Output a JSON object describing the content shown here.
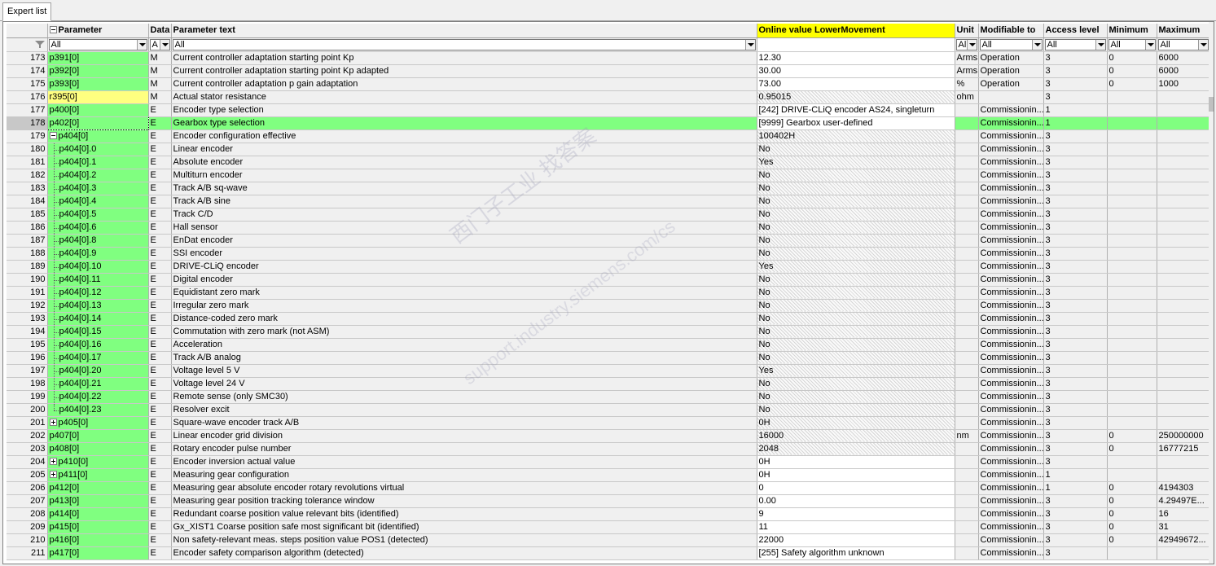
{
  "tab": {
    "label": "Expert list"
  },
  "headers": {
    "parameter": "Parameter",
    "data": "Data",
    "text": "Parameter text",
    "online": "Online value LowerMovement",
    "unit": "Unit",
    "modifiable": "Modifiable to",
    "access": "Access level",
    "minimum": "Minimum",
    "maximum": "Maximum"
  },
  "filters": {
    "parameter": "All",
    "data": "A",
    "text": "All",
    "unit": "Al",
    "modifiable": "All",
    "access": "All",
    "minimum": "All",
    "maximum": "All"
  },
  "watermark": {
    "line1": "西门子工业   找答案",
    "line2": "support.industry.siemens.com/cs"
  },
  "colors": {
    "parameter_green": "#80ff80",
    "online_header_yellow": "#ffff00",
    "read_only_param": "#ffff80"
  },
  "rows": [
    {
      "no": "173",
      "par": "p391[0]",
      "data": "M",
      "text": "Current controller adaptation starting point Kp",
      "online": "12.30",
      "unit": "Arms",
      "mod": "Operation",
      "acc": "3",
      "min": "0",
      "max": "6000",
      "ro": false
    },
    {
      "no": "174",
      "par": "p392[0]",
      "data": "M",
      "text": "Current controller adaptation starting point Kp adapted",
      "online": "30.00",
      "unit": "Arms",
      "mod": "Operation",
      "acc": "3",
      "min": "0",
      "max": "6000",
      "ro": false
    },
    {
      "no": "175",
      "par": "p393[0]",
      "data": "M",
      "text": "Current controller adaptation p gain adaptation",
      "online": "73.00",
      "unit": "%",
      "mod": "Operation",
      "acc": "3",
      "min": "0",
      "max": "1000",
      "ro": false
    },
    {
      "no": "176",
      "par": "r395[0]",
      "data": "M",
      "text": "Actual stator resistance",
      "online": "0.95015",
      "unit": "ohm",
      "mod": "",
      "acc": "3",
      "min": "",
      "max": "",
      "ro": true,
      "yellow": true
    },
    {
      "no": "177",
      "par": "p400[0]",
      "data": "E",
      "text": "Encoder type selection",
      "online": "[242] DRIVE-CLiQ encoder AS24, singleturn",
      "unit": "",
      "mod": "Commissionin...",
      "acc": "1",
      "min": "",
      "max": "",
      "ro": false
    },
    {
      "no": "178",
      "par": "p402[0]",
      "data": "E",
      "text": "Gearbox type selection",
      "online": "[9999] Gearbox user-defined",
      "unit": "",
      "mod": "Commissionin...",
      "acc": "1",
      "min": "",
      "max": "",
      "ro": false,
      "sel": true
    },
    {
      "no": "179",
      "par": "p404[0]",
      "data": "E",
      "text": "Encoder configuration effective",
      "online": "100402H",
      "unit": "",
      "mod": "Commissionin...",
      "acc": "3",
      "min": "",
      "max": "",
      "ro": true,
      "tree": "minus"
    },
    {
      "no": "180",
      "par": "p404[0].0",
      "data": "E",
      "text": "Linear encoder",
      "online": "No",
      "unit": "",
      "mod": "Commissionin...",
      "acc": "3",
      "min": "",
      "max": "",
      "ro": true,
      "child": true
    },
    {
      "no": "181",
      "par": "p404[0].1",
      "data": "E",
      "text": "Absolute encoder",
      "online": "Yes",
      "unit": "",
      "mod": "Commissionin...",
      "acc": "3",
      "min": "",
      "max": "",
      "ro": true,
      "child": true
    },
    {
      "no": "182",
      "par": "p404[0].2",
      "data": "E",
      "text": "Multiturn encoder",
      "online": "No",
      "unit": "",
      "mod": "Commissionin...",
      "acc": "3",
      "min": "",
      "max": "",
      "ro": true,
      "child": true
    },
    {
      "no": "183",
      "par": "p404[0].3",
      "data": "E",
      "text": "Track A/B sq-wave",
      "online": "No",
      "unit": "",
      "mod": "Commissionin...",
      "acc": "3",
      "min": "",
      "max": "",
      "ro": true,
      "child": true
    },
    {
      "no": "184",
      "par": "p404[0].4",
      "data": "E",
      "text": "Track A/B sine",
      "online": "No",
      "unit": "",
      "mod": "Commissionin...",
      "acc": "3",
      "min": "",
      "max": "",
      "ro": true,
      "child": true
    },
    {
      "no": "185",
      "par": "p404[0].5",
      "data": "E",
      "text": "Track C/D",
      "online": "No",
      "unit": "",
      "mod": "Commissionin...",
      "acc": "3",
      "min": "",
      "max": "",
      "ro": true,
      "child": true
    },
    {
      "no": "186",
      "par": "p404[0].6",
      "data": "E",
      "text": "Hall sensor",
      "online": "No",
      "unit": "",
      "mod": "Commissionin...",
      "acc": "3",
      "min": "",
      "max": "",
      "ro": true,
      "child": true
    },
    {
      "no": "187",
      "par": "p404[0].8",
      "data": "E",
      "text": "EnDat encoder",
      "online": "No",
      "unit": "",
      "mod": "Commissionin...",
      "acc": "3",
      "min": "",
      "max": "",
      "ro": true,
      "child": true
    },
    {
      "no": "188",
      "par": "p404[0].9",
      "data": "E",
      "text": "SSI encoder",
      "online": "No",
      "unit": "",
      "mod": "Commissionin...",
      "acc": "3",
      "min": "",
      "max": "",
      "ro": true,
      "child": true
    },
    {
      "no": "189",
      "par": "p404[0].10",
      "data": "E",
      "text": "DRIVE-CLiQ encoder",
      "online": "Yes",
      "unit": "",
      "mod": "Commissionin...",
      "acc": "3",
      "min": "",
      "max": "",
      "ro": true,
      "child": true
    },
    {
      "no": "190",
      "par": "p404[0].11",
      "data": "E",
      "text": "Digital encoder",
      "online": "No",
      "unit": "",
      "mod": "Commissionin...",
      "acc": "3",
      "min": "",
      "max": "",
      "ro": true,
      "child": true
    },
    {
      "no": "191",
      "par": "p404[0].12",
      "data": "E",
      "text": "Equidistant zero mark",
      "online": "No",
      "unit": "",
      "mod": "Commissionin...",
      "acc": "3",
      "min": "",
      "max": "",
      "ro": true,
      "child": true
    },
    {
      "no": "192",
      "par": "p404[0].13",
      "data": "E",
      "text": "Irregular zero mark",
      "online": "No",
      "unit": "",
      "mod": "Commissionin...",
      "acc": "3",
      "min": "",
      "max": "",
      "ro": true,
      "child": true
    },
    {
      "no": "193",
      "par": "p404[0].14",
      "data": "E",
      "text": "Distance-coded zero mark",
      "online": "No",
      "unit": "",
      "mod": "Commissionin...",
      "acc": "3",
      "min": "",
      "max": "",
      "ro": true,
      "child": true
    },
    {
      "no": "194",
      "par": "p404[0].15",
      "data": "E",
      "text": "Commutation with zero mark (not ASM)",
      "online": "No",
      "unit": "",
      "mod": "Commissionin...",
      "acc": "3",
      "min": "",
      "max": "",
      "ro": true,
      "child": true
    },
    {
      "no": "195",
      "par": "p404[0].16",
      "data": "E",
      "text": "Acceleration",
      "online": "No",
      "unit": "",
      "mod": "Commissionin...",
      "acc": "3",
      "min": "",
      "max": "",
      "ro": true,
      "child": true
    },
    {
      "no": "196",
      "par": "p404[0].17",
      "data": "E",
      "text": "Track A/B analog",
      "online": "No",
      "unit": "",
      "mod": "Commissionin...",
      "acc": "3",
      "min": "",
      "max": "",
      "ro": true,
      "child": true
    },
    {
      "no": "197",
      "par": "p404[0].20",
      "data": "E",
      "text": "Voltage level 5 V",
      "online": "Yes",
      "unit": "",
      "mod": "Commissionin...",
      "acc": "3",
      "min": "",
      "max": "",
      "ro": true,
      "child": true
    },
    {
      "no": "198",
      "par": "p404[0].21",
      "data": "E",
      "text": "Voltage level 24 V",
      "online": "No",
      "unit": "",
      "mod": "Commissionin...",
      "acc": "3",
      "min": "",
      "max": "",
      "ro": true,
      "child": true
    },
    {
      "no": "199",
      "par": "p404[0].22",
      "data": "E",
      "text": "Remote sense (only SMC30)",
      "online": "No",
      "unit": "",
      "mod": "Commissionin...",
      "acc": "3",
      "min": "",
      "max": "",
      "ro": true,
      "child": true
    },
    {
      "no": "200",
      "par": "p404[0].23",
      "data": "E",
      "text": "Resolver excit",
      "online": "No",
      "unit": "",
      "mod": "Commissionin...",
      "acc": "3",
      "min": "",
      "max": "",
      "ro": true,
      "child": true,
      "last": true
    },
    {
      "no": "201",
      "par": "p405[0]",
      "data": "E",
      "text": "Square-wave encoder track A/B",
      "online": "0H",
      "unit": "",
      "mod": "Commissionin...",
      "acc": "3",
      "min": "",
      "max": "",
      "ro": true,
      "tree": "plus"
    },
    {
      "no": "202",
      "par": "p407[0]",
      "data": "E",
      "text": "Linear encoder grid division",
      "online": "16000",
      "unit": "nm",
      "mod": "Commissionin...",
      "acc": "3",
      "min": "0",
      "max": "250000000",
      "ro": true
    },
    {
      "no": "203",
      "par": "p408[0]",
      "data": "E",
      "text": "Rotary encoder pulse number",
      "online": "2048",
      "unit": "",
      "mod": "Commissionin...",
      "acc": "3",
      "min": "0",
      "max": "16777215",
      "ro": true
    },
    {
      "no": "204",
      "par": "p410[0]",
      "data": "E",
      "text": "Encoder inversion actual value",
      "online": "0H",
      "unit": "",
      "mod": "Commissionin...",
      "acc": "3",
      "min": "",
      "max": "",
      "ro": false,
      "tree": "plus"
    },
    {
      "no": "205",
      "par": "p411[0]",
      "data": "E",
      "text": "Measuring gear configuration",
      "online": "0H",
      "unit": "",
      "mod": "Commissionin...",
      "acc": "1",
      "min": "",
      "max": "",
      "ro": false,
      "tree": "plus"
    },
    {
      "no": "206",
      "par": "p412[0]",
      "data": "E",
      "text": "Measuring gear absolute encoder rotary revolutions virtual",
      "online": "0",
      "unit": "",
      "mod": "Commissionin...",
      "acc": "1",
      "min": "0",
      "max": "4194303",
      "ro": false
    },
    {
      "no": "207",
      "par": "p413[0]",
      "data": "E",
      "text": "Measuring gear position tracking tolerance window",
      "online": "0.00",
      "unit": "",
      "mod": "Commissionin...",
      "acc": "3",
      "min": "0",
      "max": "4.29497E...",
      "ro": false
    },
    {
      "no": "208",
      "par": "p414[0]",
      "data": "E",
      "text": "Redundant coarse position value relevant bits (identified)",
      "online": "9",
      "unit": "",
      "mod": "Commissionin...",
      "acc": "3",
      "min": "0",
      "max": "16",
      "ro": false
    },
    {
      "no": "209",
      "par": "p415[0]",
      "data": "E",
      "text": "Gx_XIST1 Coarse position safe most significant bit (identified)",
      "online": "11",
      "unit": "",
      "mod": "Commissionin...",
      "acc": "3",
      "min": "0",
      "max": "31",
      "ro": false
    },
    {
      "no": "210",
      "par": "p416[0]",
      "data": "E",
      "text": "Non safety-relevant meas. steps position value POS1 (detected)",
      "online": "22000",
      "unit": "",
      "mod": "Commissionin...",
      "acc": "3",
      "min": "0",
      "max": "42949672...",
      "ro": false
    },
    {
      "no": "211",
      "par": "p417[0]",
      "data": "E",
      "text": "Encoder safety comparison algorithm (detected)",
      "online": "[255] Safety algorithm unknown",
      "unit": "",
      "mod": "Commissionin...",
      "acc": "3",
      "min": "",
      "max": "",
      "ro": false
    }
  ]
}
